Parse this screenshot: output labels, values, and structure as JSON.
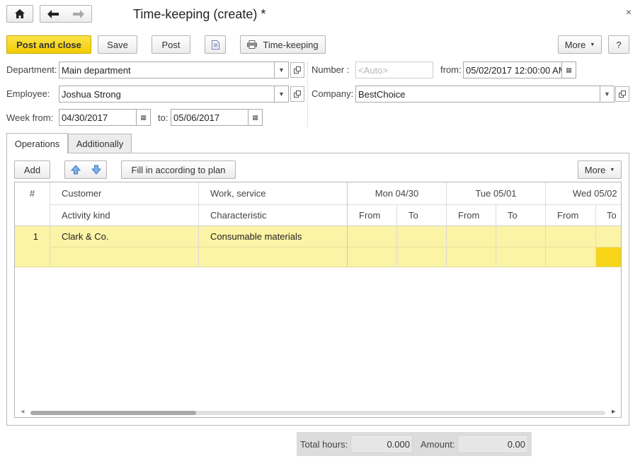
{
  "window": {
    "title": "Time-keeping (create) *"
  },
  "toolbar": {
    "post_and_close": "Post and close",
    "save": "Save",
    "post": "Post",
    "print": "Time-keeping",
    "more": "More",
    "help": "?"
  },
  "header": {
    "department_label": "Department:",
    "department_value": "Main department",
    "employee_label": "Employee:",
    "employee_value": "Joshua Strong",
    "week_from_label": "Week from:",
    "week_from_value": "04/30/2017",
    "to_label": "to:",
    "to_value": "05/06/2017",
    "number_label": "Number :",
    "number_placeholder": "<Auto>",
    "from_label": "from:",
    "from_value": "05/02/2017 12:00:00 AM",
    "company_label": "Company:",
    "company_value": "BestChoice"
  },
  "tabs": [
    {
      "label": "Operations",
      "active": true
    },
    {
      "label": "Additionally",
      "active": false
    }
  ],
  "table_toolbar": {
    "add": "Add",
    "fill": "Fill in according to plan",
    "more": "More"
  },
  "table": {
    "headers_row1": {
      "num": "#",
      "customer": "Customer",
      "work": "Work, service",
      "day1": "Mon 04/30",
      "day2": "Tue 05/01",
      "day3": "Wed 05/02"
    },
    "headers_row2": {
      "activity": "Activity kind",
      "characteristic": "Characteristic",
      "from": "From",
      "to": "To"
    },
    "rows": [
      {
        "num": "1",
        "customer": "Clark & Co.",
        "work": "Consumable materials",
        "activity": "",
        "characteristic": ""
      }
    ]
  },
  "footer": {
    "total_hours_label": "Total hours:",
    "total_hours_value": "0.000",
    "amount_label": "Amount:",
    "amount_value": "0.00"
  },
  "colors": {
    "primary_button": "#f5d20f",
    "selected_row": "#fbf3a5",
    "active_cell": "#f7d417"
  }
}
